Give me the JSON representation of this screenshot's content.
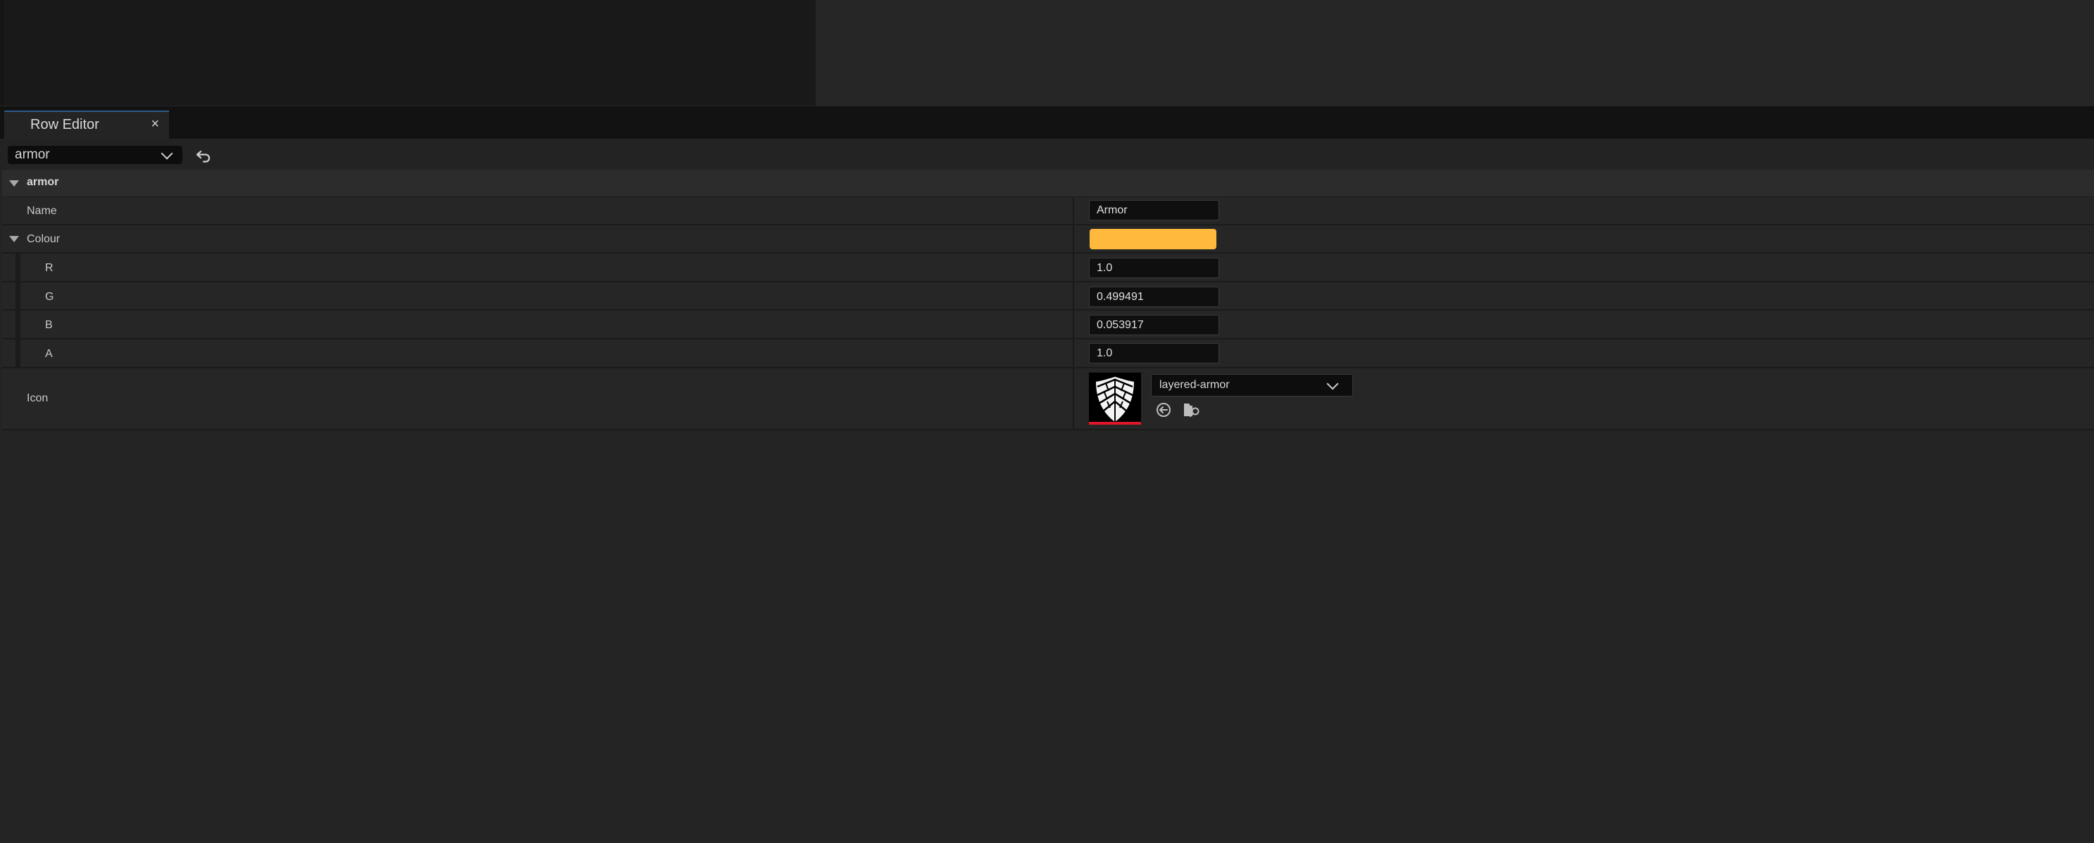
{
  "tab": {
    "title": "Row Editor",
    "close_glyph": "×"
  },
  "toolbar": {
    "row_selected": "armor",
    "undo_icon": "undo-arrow-icon"
  },
  "category": {
    "label": "armor"
  },
  "properties": {
    "name": {
      "label": "Name",
      "value": "Armor"
    },
    "colour": {
      "label": "Colour",
      "swatch_color": "#FFB93C",
      "channels": [
        {
          "label": "R",
          "value": "1.0"
        },
        {
          "label": "G",
          "value": "0.499491"
        },
        {
          "label": "B",
          "value": "0.053917"
        },
        {
          "label": "A",
          "value": "1.0"
        }
      ]
    },
    "icon": {
      "label": "Icon",
      "asset": "layered-armor",
      "thumbnail_icon": "layered-armor-icon",
      "use_selected_icon": "use-selected-arrow-icon",
      "browse_icon": "browse-folder-icon"
    }
  },
  "colors": {
    "accent_tab": "#2D5D8C",
    "thumbnail_bar": "#E0162B"
  }
}
